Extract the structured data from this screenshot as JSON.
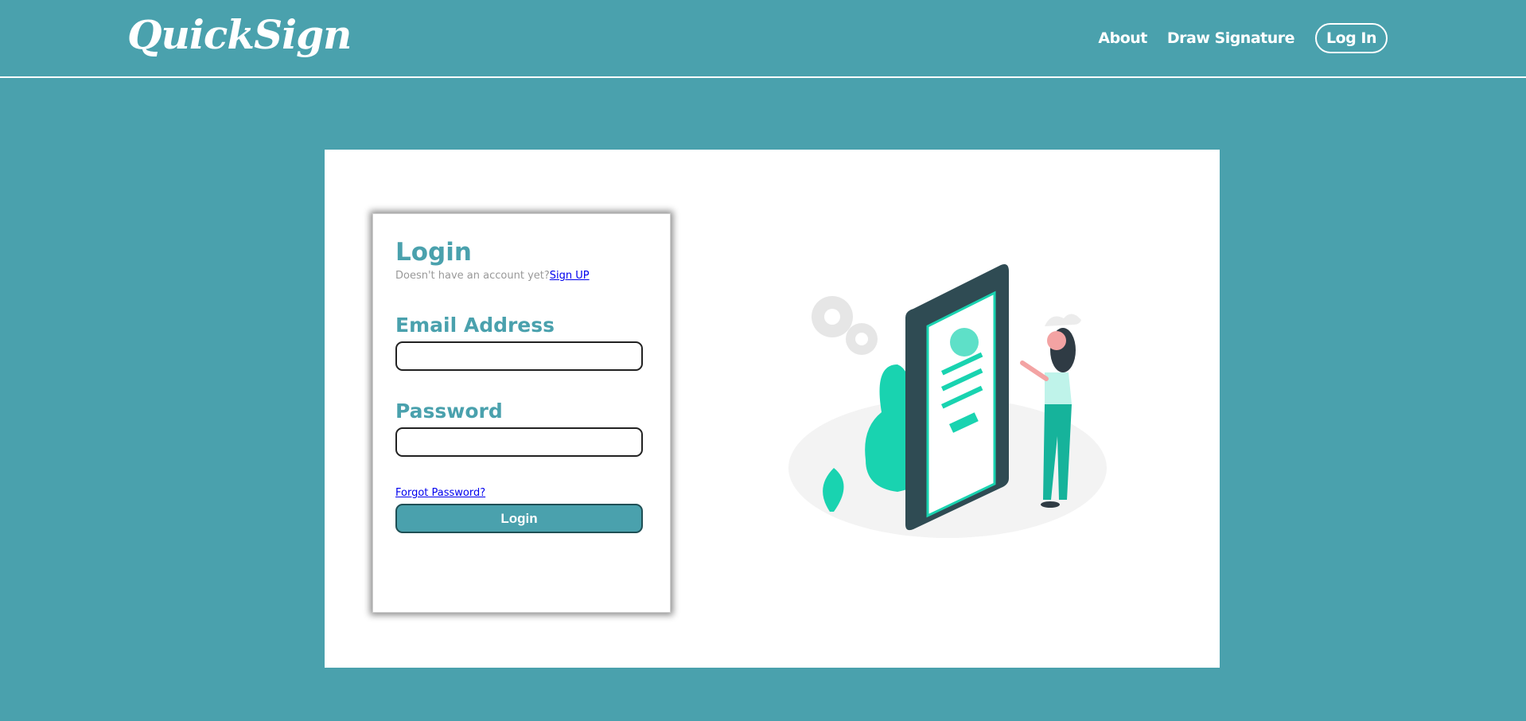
{
  "header": {
    "brand": "QuickSign",
    "nav": {
      "about": "About",
      "draw_signature": "Draw Signature",
      "login": "Log In"
    }
  },
  "login_form": {
    "title": "Login",
    "no_account_text": "Doesn't have an account yet?",
    "signup_link": "Sign UP",
    "email_label": "Email Address",
    "email_value": "",
    "password_label": "Password",
    "password_value": "",
    "forgot_link": "Forgot Password?",
    "submit_label": "Login"
  },
  "colors": {
    "brand_teal": "#4aa1ad",
    "illustration_accent": "#19d3b0",
    "phone_dark": "#2f4b53"
  },
  "icons": {
    "illustration": "person-with-phone-login-illustration"
  }
}
